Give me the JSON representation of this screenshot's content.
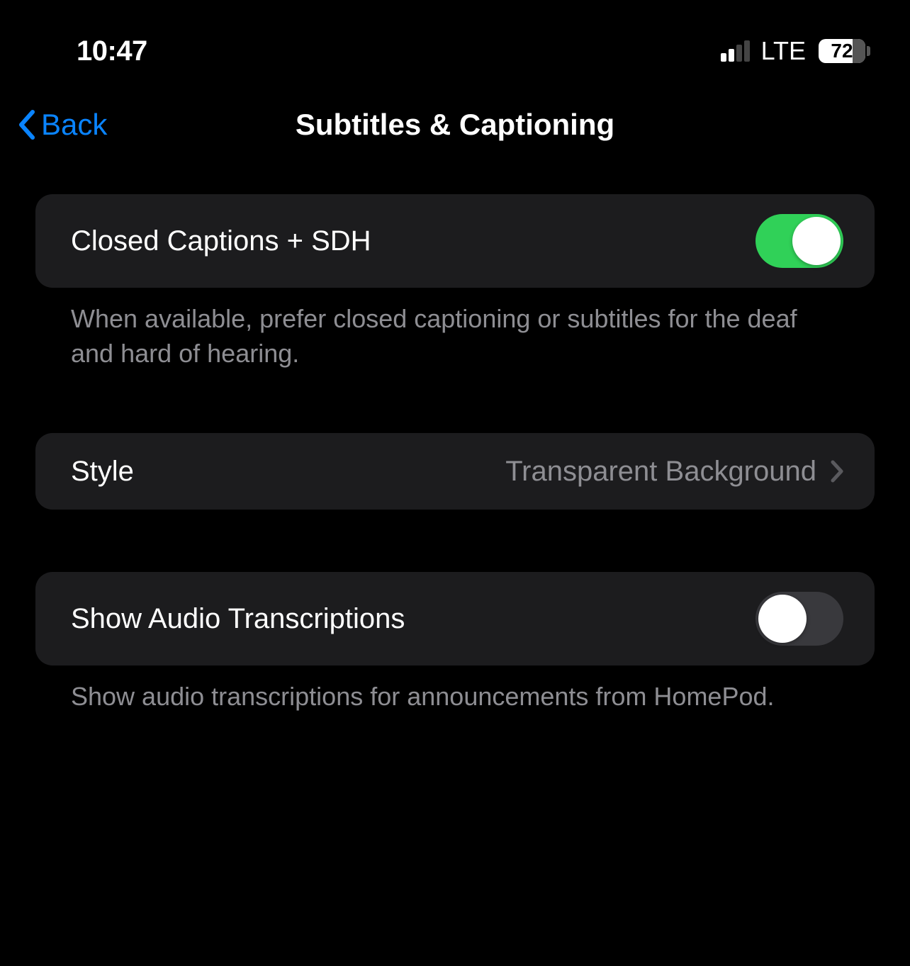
{
  "status_bar": {
    "time": "10:47",
    "cellular_active_bars": 2,
    "network_label": "LTE",
    "battery_percent": "72"
  },
  "nav": {
    "back_label": "Back",
    "title": "Subtitles & Captioning"
  },
  "sections": {
    "captions": {
      "toggle_label": "Closed Captions + SDH",
      "toggle_on": true,
      "footer": "When available, prefer closed captioning or subtitles for the deaf and hard of hearing."
    },
    "style": {
      "label": "Style",
      "value": "Transparent Background"
    },
    "transcriptions": {
      "toggle_label": "Show Audio Transcriptions",
      "toggle_on": false,
      "footer": "Show audio transcriptions for announcements from HomePod."
    }
  }
}
